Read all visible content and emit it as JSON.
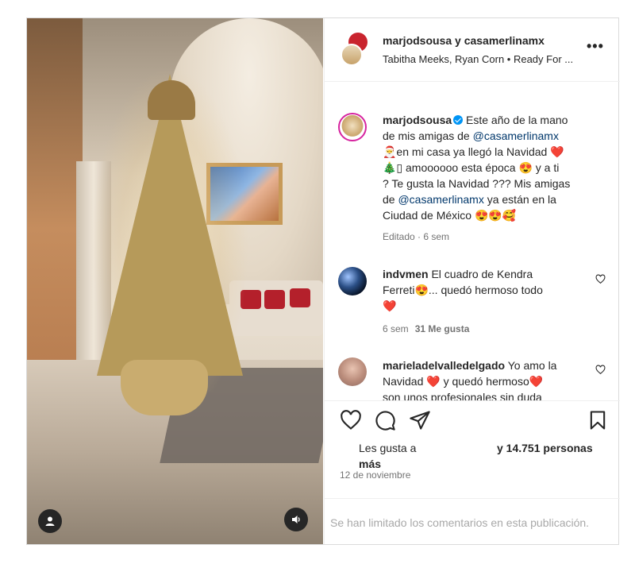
{
  "header": {
    "title": "marjodsousa y casamerlinamx",
    "subtitle": "Tabitha Meeks, Ryan Corn • Ready For ...",
    "more_label": "•••"
  },
  "caption": {
    "username": "marjodsousa",
    "verified": true,
    "line1": "Este año de la mano",
    "line2_pre": "de mis amigas de ",
    "mention1": "@casamerlinamx",
    "line3": "🎅en mi casa ya llegó la Navidad ❤️",
    "line4": "🎄▯ amoooooo esta época 😍 y a ti",
    "line5": "? Te gusta la Navidad ??? Mis amigas",
    "line6_pre": "de ",
    "mention2": "@casamerlinamx",
    "line6_post": " ya están en la",
    "line7": "Ciudad de México 😍😍🥰",
    "meta": "Editado · 6 sem"
  },
  "comments": [
    {
      "username": "indvmen",
      "text_line1": "El cuadro de Kendra",
      "text_line2": "Ferreti😍... quedó hermoso todo",
      "text_line3": "❤️",
      "time": "6 sem",
      "likes": "31 Me gusta"
    },
    {
      "username": "marieladelvalledelgado",
      "text_line1": "Yo amo la",
      "text_line2": "Navidad ❤️ y quedó hermoso❤️",
      "text_line3": "son unos profesionales sin duda"
    }
  ],
  "likes": {
    "prefix": "Les gusta a",
    "more": "más",
    "count_text": "y 14.751 personas"
  },
  "date": "12 de noviembre",
  "comments_limited": "Se han limitado los comentarios en esta publicación.",
  "icons": {
    "like": "heart-icon",
    "comment": "comment-icon",
    "share": "paper-plane-icon",
    "save": "bookmark-icon",
    "user_tags": "user-icon",
    "audio": "speaker-icon"
  },
  "colors": {
    "link": "#00376b",
    "verified": "#0095f6",
    "meta": "#737373",
    "heart": "#e0245e"
  }
}
